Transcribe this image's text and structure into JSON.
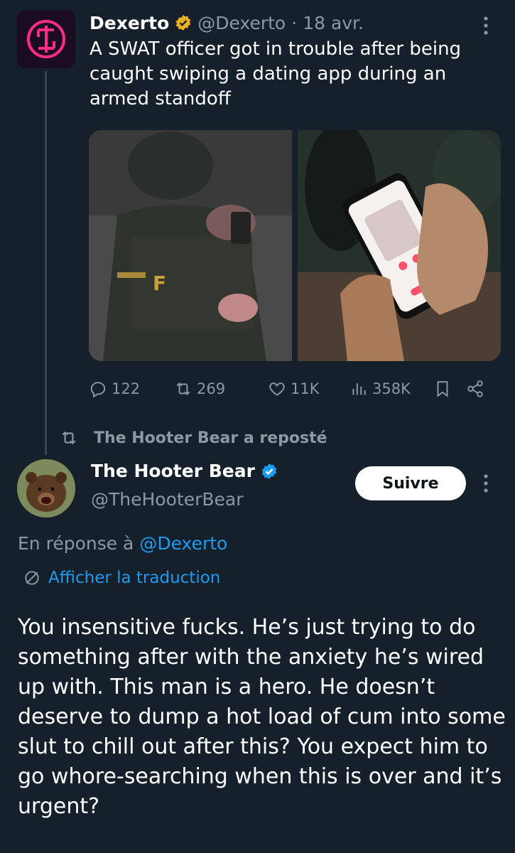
{
  "quoted_tweet": {
    "name": "Dexerto",
    "handle": "@Dexerto",
    "separator": "·",
    "date": "18 avr.",
    "text": "A SWAT officer got in trouble after being caught swiping a dating app during an armed standoff",
    "stats": {
      "replies": "122",
      "reposts": "269",
      "likes": "11K",
      "views": "358K"
    }
  },
  "repost_label": "The Hooter Bear a reposté",
  "tweet": {
    "name": "The Hooter Bear",
    "handle": "@TheHooterBear",
    "follow_label": "Suivre",
    "reply_prefix": "En réponse à",
    "reply_to": "@Dexerto",
    "translate_label": "Afficher la traduction",
    "text": "You insensitive fucks. He’s just trying to do something after with the anxiety he’s wired up with. This man is a hero. He doesn’t deserve to dump a hot load of cum into some slut to chill out after this? You expect him to go whore-searching when this is over and it’s urgent?"
  },
  "colors": {
    "background": "#15202b",
    "muted": "#8b98a5",
    "accent": "#1d9bf0",
    "gold_badge": "#e8b022"
  },
  "icons": [
    "more-icon",
    "verified-gold-icon",
    "verified-blue-icon",
    "reply-icon",
    "retweet-icon",
    "like-icon",
    "views-icon",
    "bookmark-icon",
    "share-icon",
    "translate-icon"
  ]
}
